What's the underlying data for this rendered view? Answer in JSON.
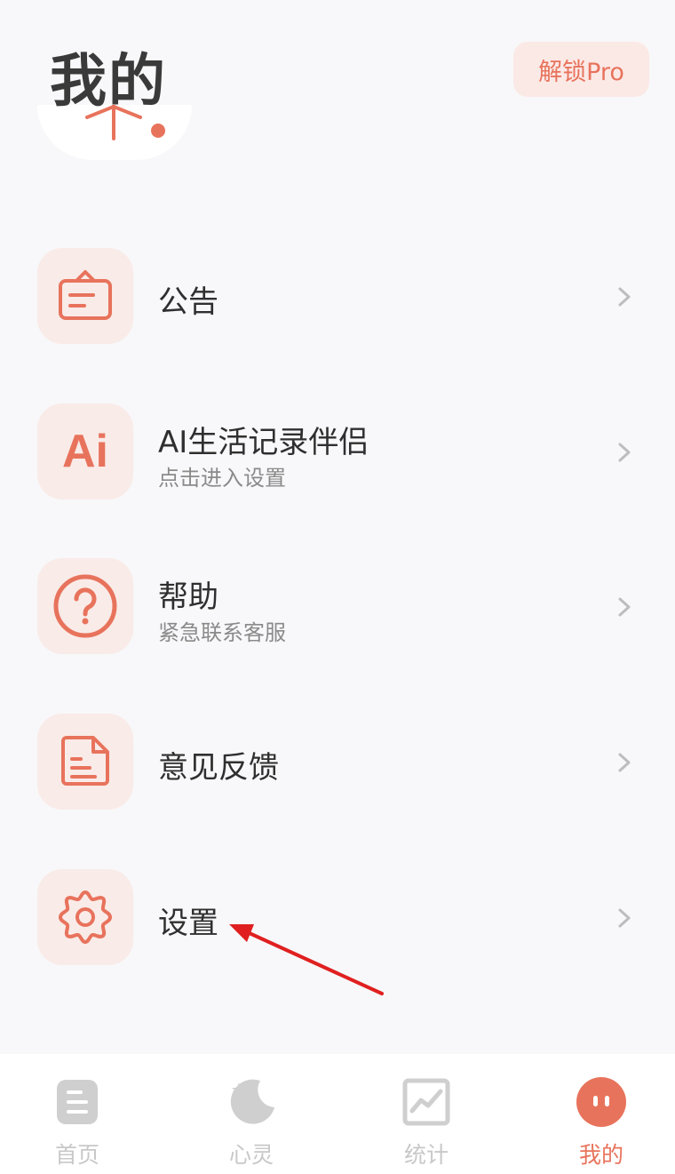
{
  "header": {
    "title": "我的",
    "pro_button": "解锁Pro"
  },
  "menu": [
    {
      "id": "notice",
      "title": "公告",
      "subtitle": "",
      "icon": "notice-board-icon"
    },
    {
      "id": "ai",
      "title": "AI生活记录伴侣",
      "subtitle": "点击进入设置",
      "icon": "ai-icon",
      "icon_text": "Ai"
    },
    {
      "id": "help",
      "title": "帮助",
      "subtitle": "紧急联系客服",
      "icon": "question-circle-icon"
    },
    {
      "id": "feedback",
      "title": "意见反馈",
      "subtitle": "",
      "icon": "document-icon"
    },
    {
      "id": "settings",
      "title": "设置",
      "subtitle": "",
      "icon": "gear-icon"
    }
  ],
  "tabs": [
    {
      "label": "首页",
      "icon": "home-list-icon",
      "active": false
    },
    {
      "label": "心灵",
      "icon": "moon-star-icon",
      "active": false
    },
    {
      "label": "统计",
      "icon": "chart-icon",
      "active": false
    },
    {
      "label": "我的",
      "icon": "profile-face-icon",
      "active": true
    }
  ],
  "colors": {
    "accent": "#e8735c",
    "icon_bg": "#f9ebe8",
    "inactive": "#c8c8c8",
    "annotation_arrow": "#e02020"
  }
}
